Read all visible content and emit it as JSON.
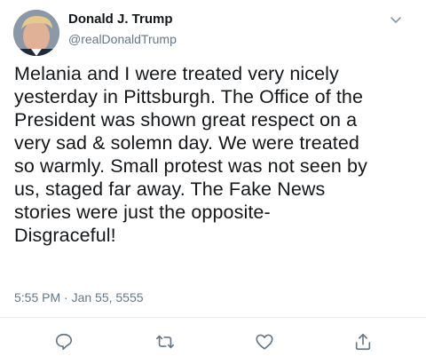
{
  "tweet": {
    "author_name": "Donald J. Trump",
    "author_handle": "@realDonaldTrump",
    "text": "Melania and I were treated very nicely\nyesterday in Pittsburgh. The Office of the\nPresident was shown great respect on a\nvery sad & solemn day. We were treated\nso warmly. Small protest was not seen by\nus, staged far away. The Fake News\nstories were just the opposite-\nDisgraceful!",
    "timestamp": "5:55 PM · Jan 55, 5555"
  },
  "icons": {
    "menu": "chevron-down-icon",
    "reply": "reply-icon",
    "retweet": "retweet-icon",
    "like": "heart-icon",
    "share": "share-icon"
  },
  "colors": {
    "text": "#14171a",
    "secondary": "#657786",
    "divider": "#e6ecf0"
  }
}
